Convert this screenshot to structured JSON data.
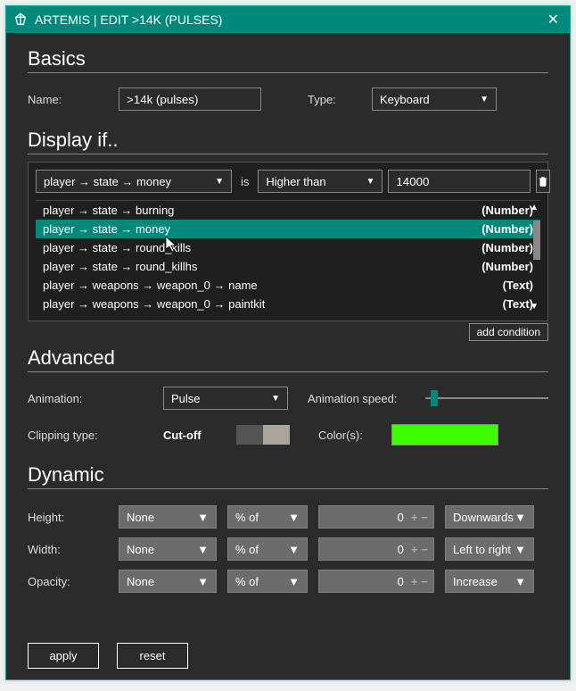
{
  "window": {
    "title": "ARTEMIS | EDIT >14K (PULSES)"
  },
  "basics": {
    "heading": "Basics",
    "name_label": "Name:",
    "name_value": ">14k (pulses)",
    "type_label": "Type:",
    "type_value": "Keyboard"
  },
  "display_if": {
    "heading": "Display if..",
    "property": "player → state → money",
    "is_label": "is",
    "operator": "Higher than",
    "value": "14000",
    "add_condition": "add condition",
    "options": [
      {
        "path": "player → state → burning",
        "type": "(Number)",
        "selected": false
      },
      {
        "path": "player → state → money",
        "type": "(Number)",
        "selected": true
      },
      {
        "path": "player → state → round_kills",
        "type": "(Number)",
        "selected": false
      },
      {
        "path": "player → state → round_killhs",
        "type": "(Number)",
        "selected": false
      },
      {
        "path": "player → weapons → weapon_0 → name",
        "type": "(Text)",
        "selected": false
      },
      {
        "path": "player → weapons → weapon_0 → paintkit",
        "type": "(Text)",
        "selected": false
      }
    ]
  },
  "advanced": {
    "heading": "Advanced",
    "animation_label": "Animation:",
    "animation_value": "Pulse",
    "speed_label": "Animation speed:",
    "clipping_label": "Clipping type:",
    "clipping_value": "Cut-off",
    "colors_label": "Color(s):",
    "color_value": "#3eff00"
  },
  "dynamic": {
    "heading": "Dynamic",
    "rows": [
      {
        "label": "Height:",
        "source": "None",
        "unit": "% of",
        "value": "0",
        "dir": "Downwards"
      },
      {
        "label": "Width:",
        "source": "None",
        "unit": "% of",
        "value": "0",
        "dir": "Left to right"
      },
      {
        "label": "Opacity:",
        "source": "None",
        "unit": "% of",
        "value": "0",
        "dir": "Increase"
      }
    ]
  },
  "footer": {
    "apply": "apply",
    "reset": "reset"
  }
}
